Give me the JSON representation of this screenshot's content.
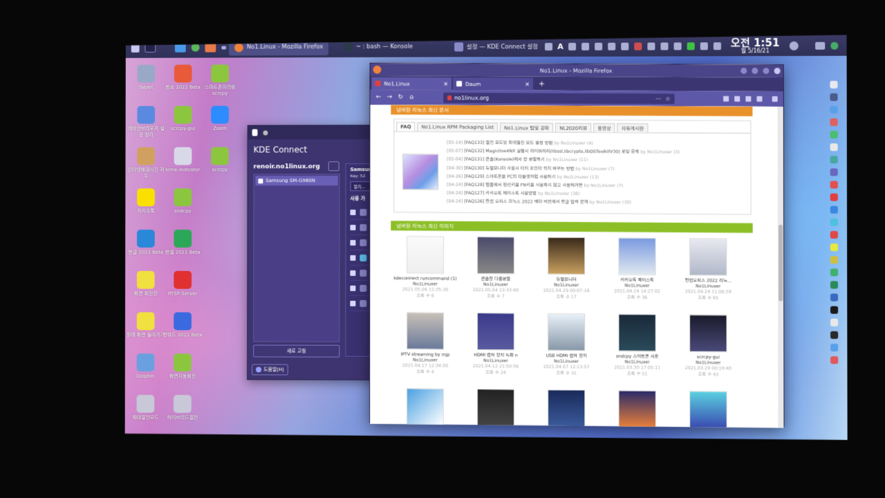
{
  "panel": {
    "tasks": [
      {
        "label": "No1.Linux - Mozilla Firefox",
        "color": "#f0823c"
      },
      {
        "label": "~ : bash — Konsole",
        "color": "#2b3a4a"
      },
      {
        "label": "설정 — KDE Connect 설정",
        "color": "#8a8ac8"
      }
    ],
    "clock_time": "오전 1:51",
    "clock_date": "월 5/16/21"
  },
  "desktop_icons": [
    {
      "label": "Tablet",
      "icon": "folder-icon",
      "color": "#9aa8c8"
    },
    {
      "label": "한쇼 2022 Beta",
      "icon": "hanshow-icon",
      "color": "#e85a3a"
    },
    {
      "label": "스마트폰미러링 scrcpy",
      "icon": "android-icon",
      "color": "#8cc63f"
    },
    {
      "label": "데비안브라우저 설정 정리",
      "icon": "network-icon",
      "color": "#5a8ae0"
    },
    {
      "label": "scrcpy-gui",
      "icon": "android-icon",
      "color": "#8cc63f"
    },
    {
      "label": "Zoom",
      "icon": "zoom-icon",
      "color": "#2d8cff"
    },
    {
      "label": "인터넷배경사진 저주",
      "icon": "image-icon",
      "color": "#d0a060"
    },
    {
      "label": "kime-indicator",
      "icon": "kime-icon",
      "color": "#d8d8e8"
    },
    {
      "label": "scrcpy",
      "icon": "android-icon",
      "color": "#8cc63f"
    },
    {
      "label": "카카오톡",
      "icon": "kakaotalk-icon",
      "color": "#f9e000"
    },
    {
      "label": "sndcpy",
      "icon": "android-icon",
      "color": "#8cc63f"
    },
    {
      "label": "한글 2022 Beta",
      "icon": "hangul-icon",
      "color": "#2a88d8"
    },
    {
      "label": "한셀 2022 Beta",
      "icon": "hancell-icon",
      "color": "#2aa858"
    },
    {
      "label": "화면 회전전",
      "icon": "alert-icon",
      "color": "#f0e040"
    },
    {
      "label": "RTSP-Server",
      "icon": "record-icon",
      "color": "#e03030"
    },
    {
      "label": "원래 화면 돌아가기",
      "icon": "alert-icon",
      "color": "#f0e040"
    },
    {
      "label": "한워드 2022 Beta",
      "icon": "hanword-icon",
      "color": "#3a6ae0"
    },
    {
      "label": "Dolphin",
      "icon": "folder-icon",
      "color": "#6aa0e0"
    },
    {
      "label": "화면자동회전",
      "icon": "android-icon",
      "color": "#8cc63f"
    },
    {
      "label": "최대절전모드",
      "icon": "hibernate-icon",
      "color": "#c8c8d8"
    },
    {
      "label": "하이브리드절전",
      "icon": "hybrid-sleep-icon",
      "color": "#c8c8d8"
    }
  ],
  "kde": {
    "title": "KDE Connect",
    "host": "renoir.no1linux.org",
    "device": "Samsung SM-G960N",
    "device_short": "Samsun",
    "key": "Key: 52",
    "search": "찾기...",
    "plugins_header": "사용 가",
    "refresh": "새로 고침",
    "help": "도움말(H)"
  },
  "firefox": {
    "window_title": "No1.Linux - Mozilla Firefox",
    "tabs": [
      {
        "label": "No1.Linux",
        "active": true
      },
      {
        "label": "Daum",
        "active": false
      }
    ],
    "url": "no1linux.org",
    "section_faq": "넘버원 리눅스 최신 문서",
    "faq_tabs": [
      "FAQ",
      "No1.Linux RPM Packaging List",
      "No1.Linux 팁및 강좌",
      "NL2020리뷰",
      "동영상",
      "자유게시판"
    ],
    "faq_items": [
      {
        "date": "[05-14]",
        "text": "[FAQ133] 절전 모드및 최대절전 모드 설정 방법",
        "by": "by No1Linuxer (4)"
      },
      {
        "date": "[05-07]",
        "text": "[FAQ132] Magicline4NX 실행시 라이브러리(libssl,libcrypto,libDSToolkitV30) 로딩 문제",
        "by": "by No1Linuxer (3)"
      },
      {
        "date": "[05-04]",
        "text": "[FAQ131] 콘솔(Konsole)에서 창 분할하기",
        "by": "by No1Linuxer (11)"
      },
      {
        "date": "[04-30]",
        "text": "[FAQ130] 듀얼모니터 사용시 터치 포인터 위치 바꾸는 방법",
        "by": "by No1Linuxer (7)"
      },
      {
        "date": "[04-26]",
        "text": "[FAQ129] 스마트폰을 PC의 타블렛처럼 사용하기",
        "by": "by No1Linuxer (13)"
      },
      {
        "date": "[04-24]",
        "text": "[FAQ128] 앱들에서 핑선키를 FN키를 사용하지 않고 사용하려면",
        "by": "by No1Linuxer (7)"
      },
      {
        "date": "[04-24]",
        "text": "[FAQ127] 카카오톡 페이스톡 사용방법",
        "by": "by No1Linuxer (38)"
      },
      {
        "date": "[04-24]",
        "text": "[FAQ126] 한컴 오피스 리눅스 2022 베타 버전에서 한글 입력 문제",
        "by": "by No1Linuxer (30)"
      }
    ],
    "section_images": "넘버원 리눅스 최신 이미지",
    "gallery": [
      {
        "caption": "kdeconnect runcommand (1)",
        "author": "No1Linuxer",
        "datetime": "2021.05.06 11:35:30",
        "views": "조회 수 6"
      },
      {
        "caption": "콘솔창 다중분할",
        "author": "No1Linuxer",
        "datetime": "2021.05.04 13:33:40",
        "views": "조회 수 7"
      },
      {
        "caption": "듀얼모니터",
        "author": "No1Linuxer",
        "datetime": "2021.04.29 00:07:18",
        "views": "조회 수 17"
      },
      {
        "caption": "카카오톡 페이스톡",
        "author": "No1Linuxer",
        "datetime": "2021.04.24 14:27:02",
        "views": "조회 수 36"
      },
      {
        "caption": "한컴오피스 2022 리눅...",
        "author": "No1Linuxer",
        "datetime": "2021.04.24 11:06:59",
        "views": "조회 수 65"
      },
      {
        "caption": "IPTV streaming by mjp",
        "author": "No1Linuxer",
        "datetime": "2021.04.17 12:34:00",
        "views": "조회 수 4"
      },
      {
        "caption": "HDMI 캡처 장치 녹화 n",
        "author": "No1Linuxer",
        "datetime": "2021.04.12 21:50:56",
        "views": "조회 수 24"
      },
      {
        "caption": "USB HDMI 캡처 장치",
        "author": "No1Linuxer",
        "datetime": "2021.04.07 12:13:57",
        "views": "조회 수 31"
      },
      {
        "caption": "sndcpy 스마트폰 사운",
        "author": "No1Linuxer",
        "datetime": "2021.03.30 17:05:11",
        "views": "조회 수 51"
      },
      {
        "caption": "scrcpy-gui",
        "author": "No1Linuxer",
        "datetime": "2021.03.29 00:19:40",
        "views": "조회 수 43"
      }
    ]
  }
}
